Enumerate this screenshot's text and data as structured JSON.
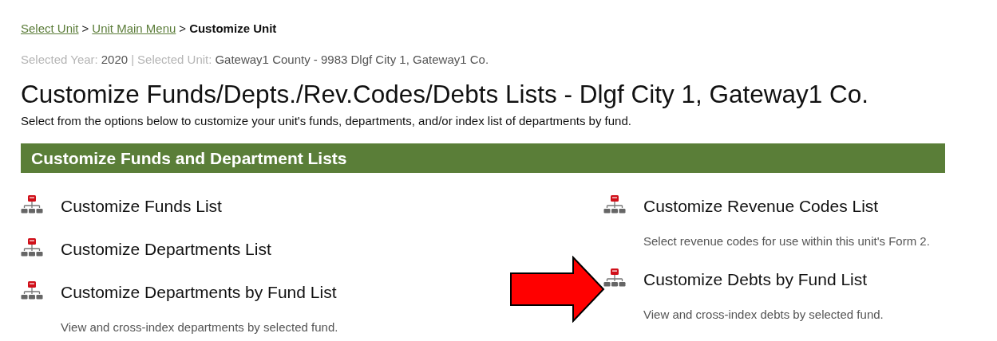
{
  "breadcrumb": {
    "separator": ">",
    "items": [
      {
        "label": "Select Unit",
        "kind": "link"
      },
      {
        "label": "Unit Main Menu",
        "kind": "link"
      },
      {
        "label": "Customize Unit",
        "kind": "current"
      }
    ]
  },
  "selection": {
    "year_label": "Selected Year:",
    "year": "2020",
    "divider": "|",
    "unit_label": "Selected Unit:",
    "unit": "Gateway1 County - 9983 Dlgf City 1, Gateway1 Co."
  },
  "title": "Customize Funds/Depts./Rev.Codes/Debts Lists - Dlgf City 1, Gateway1 Co.",
  "subtitle": "Select from the options below to customize your unit's funds, departments, and/or index list of departments by fund.",
  "section": {
    "heading": "Customize Funds and Department Lists",
    "left_items": [
      {
        "title": "Customize Funds List",
        "highlighted": false
      },
      {
        "title": "Customize Departments List",
        "highlighted": false
      },
      {
        "title": "Customize Departments by Fund List",
        "description": "View and cross-index departments by selected fund.",
        "highlighted": false
      }
    ],
    "right_items": [
      {
        "title": "Customize Revenue Codes List",
        "description": "Select revenue codes for use within this unit's Form 2.",
        "highlighted": false
      },
      {
        "title": "Customize Debts by Fund List",
        "description": "View and cross-index debts by selected fund.",
        "highlighted": true
      }
    ]
  }
}
